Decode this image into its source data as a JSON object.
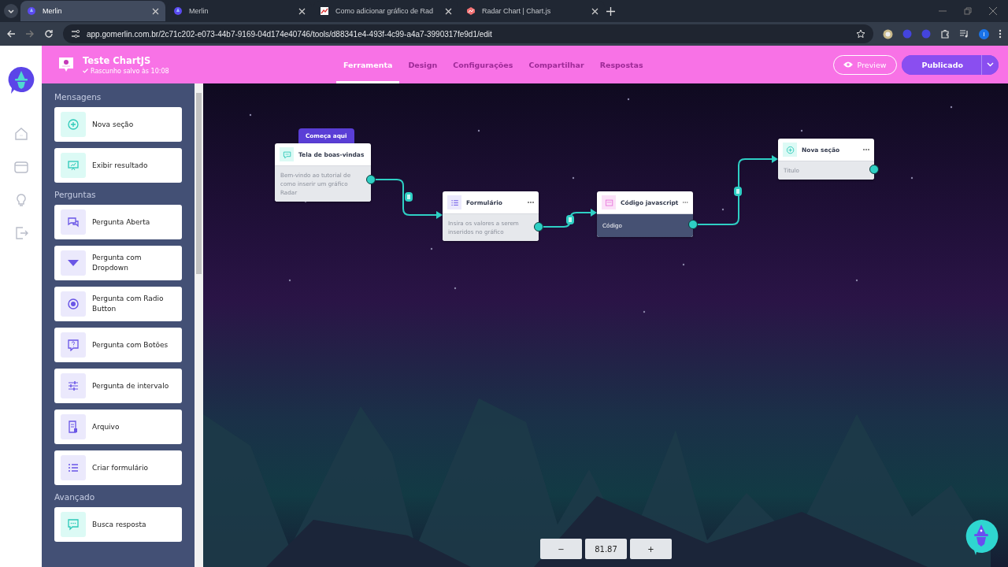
{
  "browser": {
    "tabs": [
      {
        "title": "Merlin",
        "selected": true
      },
      {
        "title": "Merlin",
        "selected": false
      },
      {
        "title": "Como adicionar gráfico de Rad",
        "selected": false
      },
      {
        "title": "Radar Chart | Chart.js",
        "selected": false
      }
    ],
    "url": "app.gomerlin.com.br/2c71c202-e073-44b7-9169-04d174e40746/tools/d88341e4-493f-4c99-a4a7-3990317fe9d1/edit",
    "profile_initial": "I"
  },
  "header": {
    "title": "Teste ChartJS",
    "status": "Rascunho salvo às 10:08",
    "tabs": [
      {
        "label": "Ferramenta",
        "selected": true
      },
      {
        "label": "Design",
        "selected": false
      },
      {
        "label": "Configurações",
        "selected": false
      },
      {
        "label": "Compartilhar",
        "selected": false
      },
      {
        "label": "Respostas",
        "selected": false
      }
    ],
    "preview_button": "Preview",
    "publish_button": "Publicado"
  },
  "sidebar": {
    "sections": [
      {
        "title": "Mensagens",
        "items": [
          {
            "label": "Nova seção",
            "kind": "section"
          },
          {
            "label": "Exibir resultado",
            "kind": "result"
          }
        ]
      },
      {
        "title": "Perguntas",
        "items": [
          {
            "label": "Pergunta Aberta",
            "kind": "open"
          },
          {
            "label": "Pergunta com Dropdown",
            "kind": "dropdown"
          },
          {
            "label": "Pergunta com Radio Button",
            "kind": "radio"
          },
          {
            "label": "Pergunta com Botões",
            "kind": "buttons"
          },
          {
            "label": "Pergunta de intervalo",
            "kind": "range"
          },
          {
            "label": "Arquivo",
            "kind": "file"
          },
          {
            "label": "Criar formulário",
            "kind": "form"
          }
        ]
      },
      {
        "title": "Avançado",
        "items": [
          {
            "label": "Busca resposta",
            "kind": "search"
          }
        ]
      }
    ]
  },
  "canvas": {
    "start_badge": "Começa aqui",
    "nodes": [
      {
        "kind": "welcome",
        "title": "Tela de boas-vindas",
        "body": "Bem-vindo ao tutorial de como inserir um gráfico Radar"
      },
      {
        "kind": "form",
        "title": "Formulário",
        "body": "Insira os valores a serem inseridos no gráfico"
      },
      {
        "kind": "code",
        "title": "Código javascript",
        "body": "Código"
      },
      {
        "kind": "section",
        "title": "Nova seção",
        "body": "Titulo"
      }
    ],
    "zoom": {
      "minus": "−",
      "value": "81.87",
      "plus": "+"
    }
  }
}
